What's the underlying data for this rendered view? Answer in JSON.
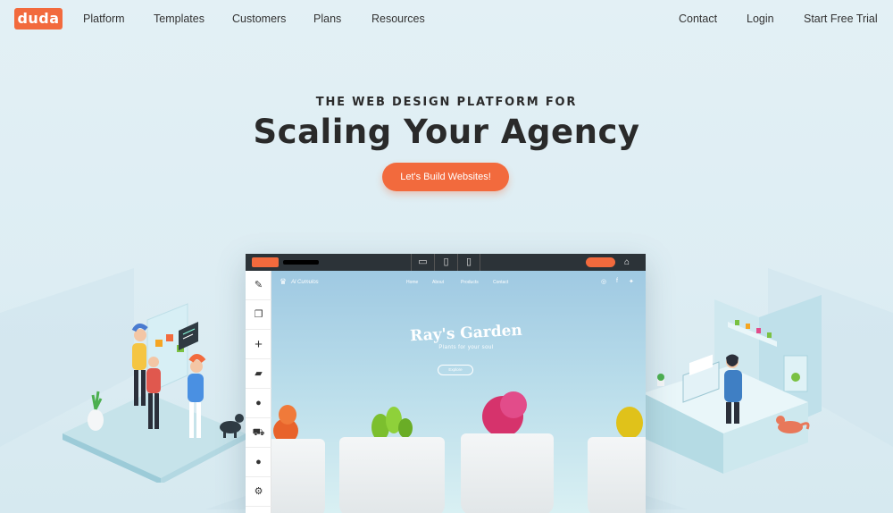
{
  "nav": {
    "logo": "duda",
    "links": [
      "Platform",
      "Templates",
      "Customers",
      "Plans",
      "Resources"
    ],
    "right_links": [
      "Contact",
      "Login",
      "Start Free Trial"
    ]
  },
  "hero": {
    "eyebrow": "THE WEB DESIGN PLATFORM FOR",
    "headline": "Scaling Your Agency",
    "cta": "Let's Build Websites!"
  },
  "editor": {
    "site": {
      "logo": "Al Cumulos",
      "nav": [
        "Home",
        "About",
        "Products",
        "Contact"
      ],
      "title": "Ray's Garden",
      "subtitle": "Plants for your soul",
      "button": "Explore"
    }
  },
  "colors": {
    "accent": "#f26a3d",
    "background": "#e3f0f5",
    "editor_topbar": "#2c3338"
  }
}
